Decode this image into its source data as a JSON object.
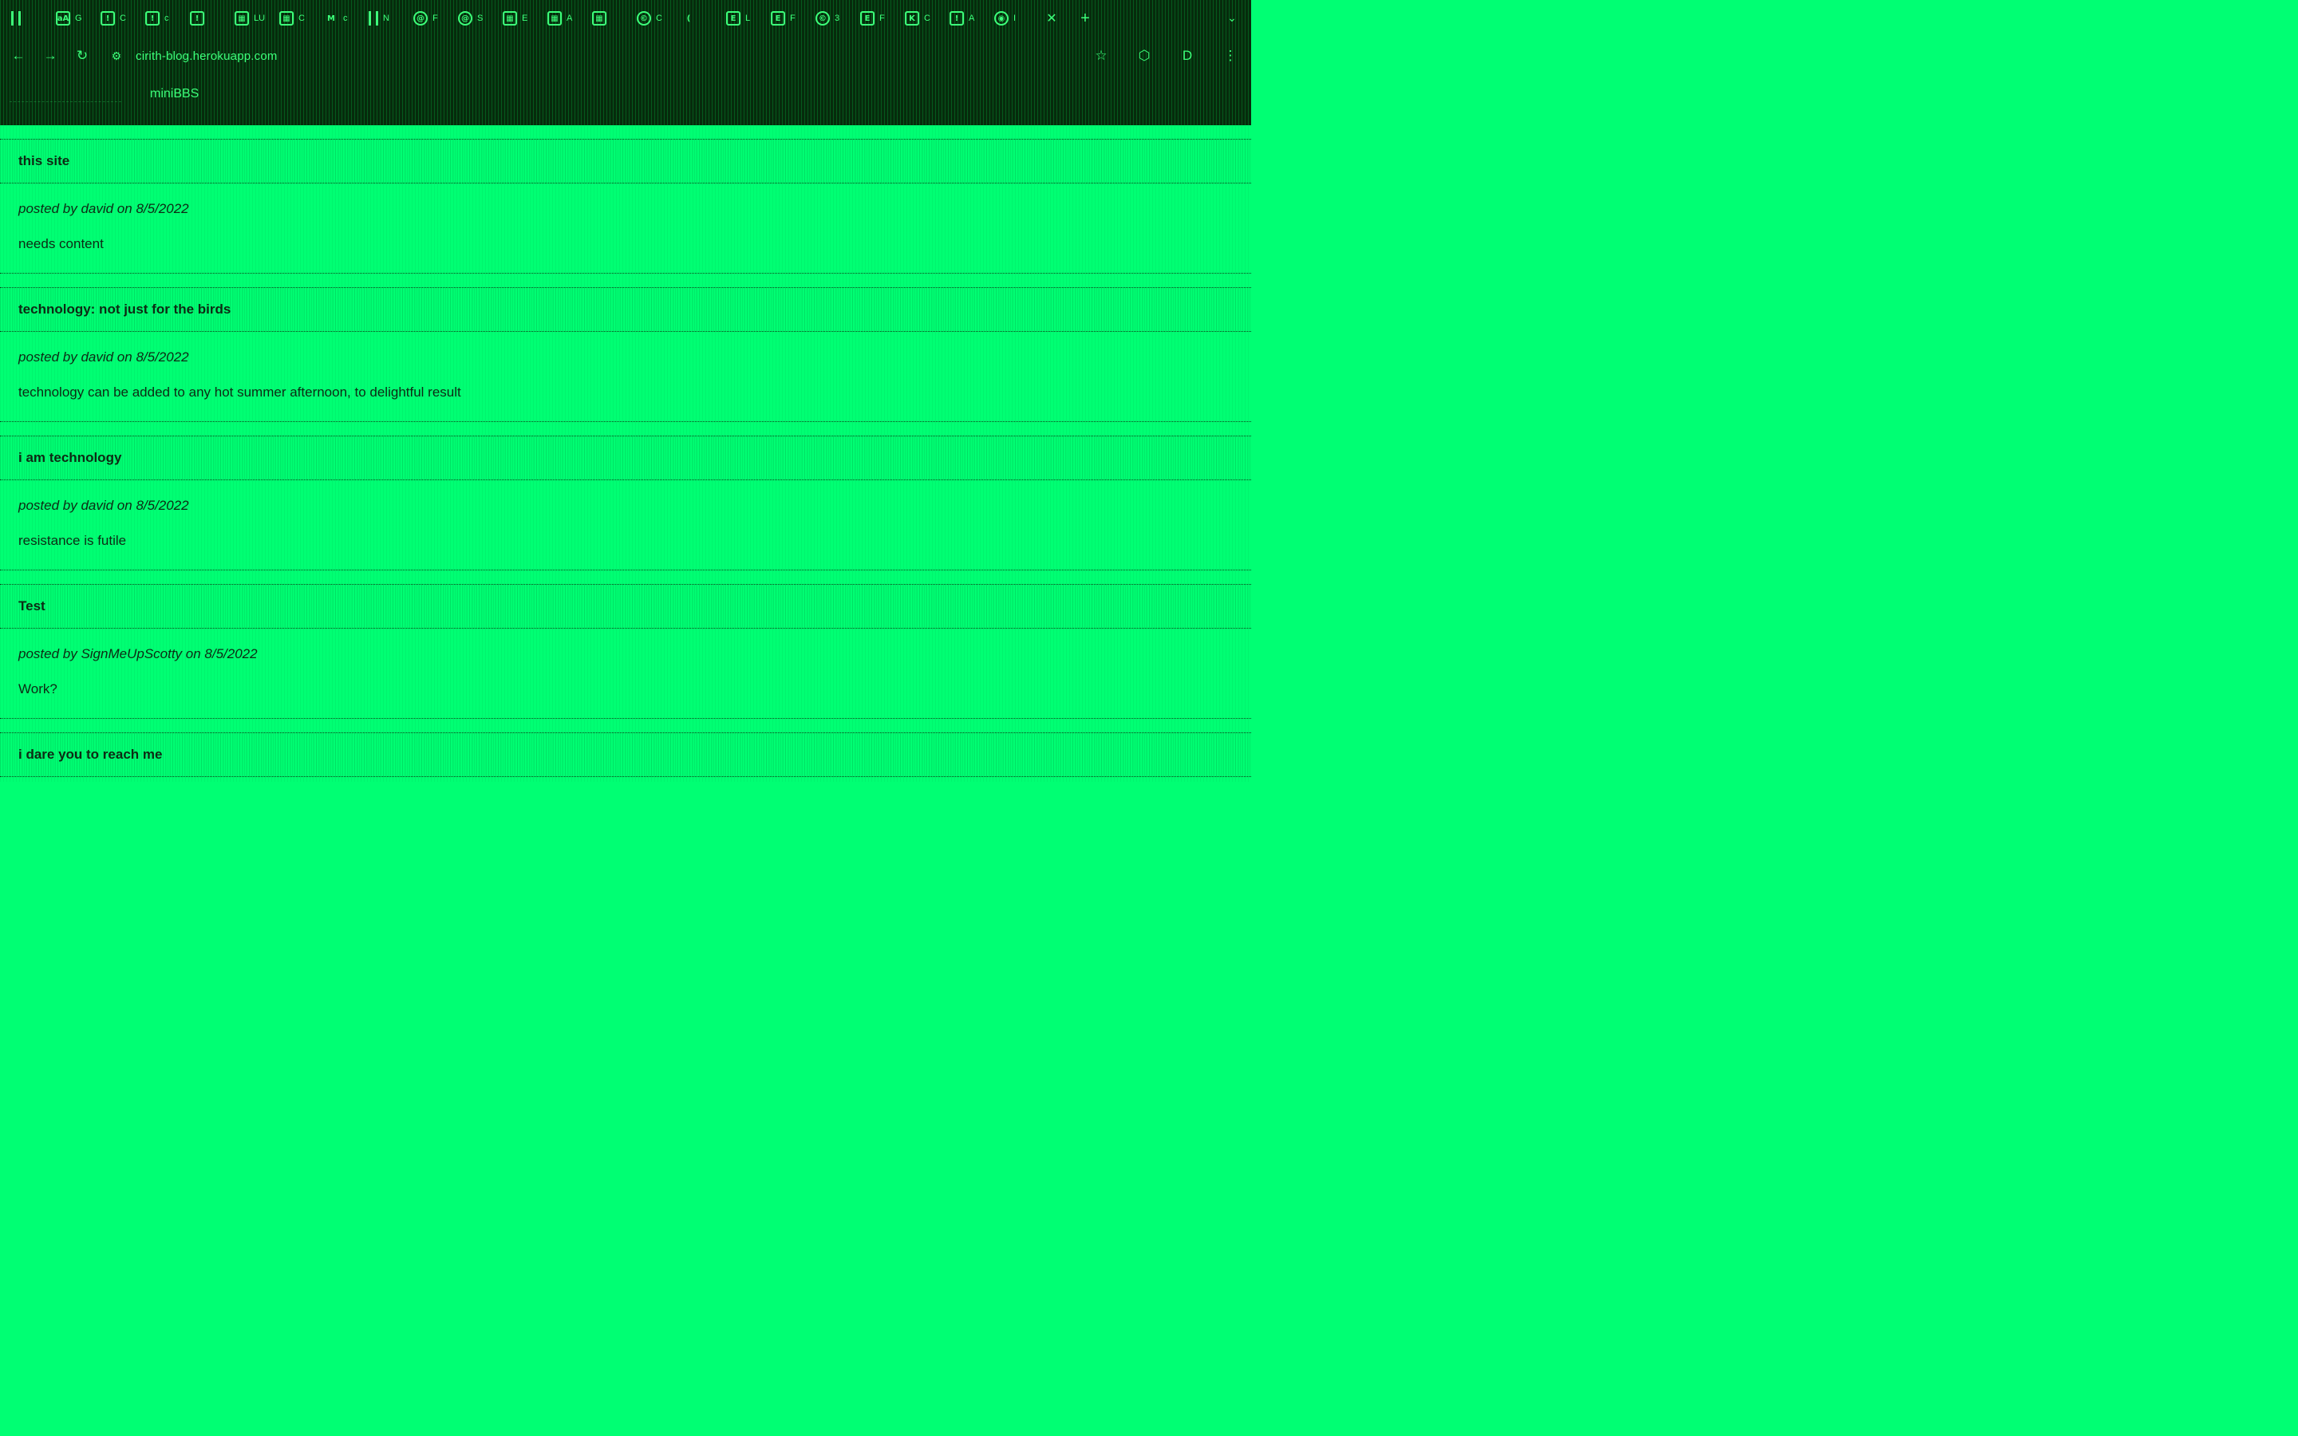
{
  "browser": {
    "tabs": [
      {
        "favicon": "bars-icon",
        "style": "bars",
        "glyph": "",
        "title": ""
      },
      {
        "favicon": "image-icon",
        "style": "box",
        "glyph": "aA",
        "title": "G"
      },
      {
        "favicon": "bookmark-icon",
        "style": "box",
        "glyph": "!",
        "title": "C"
      },
      {
        "favicon": "bookmark-icon",
        "style": "box",
        "glyph": "!",
        "title": "c"
      },
      {
        "favicon": "bookmark-icon",
        "style": "box",
        "glyph": "!",
        "title": ""
      },
      {
        "favicon": "grid-icon",
        "style": "box",
        "glyph": "▦",
        "title": "LUR"
      },
      {
        "favicon": "grid-icon",
        "style": "box",
        "glyph": "▦",
        "title": "C"
      },
      {
        "favicon": "text-icon",
        "style": "plain",
        "glyph": "M",
        "title": "c"
      },
      {
        "favicon": "bars-icon",
        "style": "bars",
        "glyph": "",
        "title": "N"
      },
      {
        "favicon": "globe-icon",
        "style": "round",
        "glyph": "@",
        "title": "F"
      },
      {
        "favicon": "globe-icon",
        "style": "round",
        "glyph": "@",
        "title": "S"
      },
      {
        "favicon": "grid-icon",
        "style": "box",
        "glyph": "▦",
        "title": "E"
      },
      {
        "favicon": "grid-icon",
        "style": "box",
        "glyph": "▦",
        "title": "A"
      },
      {
        "favicon": "grid-icon",
        "style": "box",
        "glyph": "▦",
        "title": ""
      },
      {
        "favicon": "copyright-icon",
        "style": "round",
        "glyph": "©",
        "title": "C"
      },
      {
        "favicon": "page-icon",
        "style": "plain",
        "glyph": "(",
        "title": ""
      },
      {
        "favicon": "e-icon",
        "style": "box",
        "glyph": "E",
        "title": "L"
      },
      {
        "favicon": "e-icon",
        "style": "box",
        "glyph": "E",
        "title": "F"
      },
      {
        "favicon": "copyright-icon",
        "style": "round",
        "glyph": "©",
        "title": "3"
      },
      {
        "favicon": "e-icon",
        "style": "box",
        "glyph": "E",
        "title": "F"
      },
      {
        "favicon": "k-icon",
        "style": "box",
        "glyph": "K",
        "title": "C"
      },
      {
        "favicon": "bookmark-icon",
        "style": "box",
        "glyph": "!",
        "title": "A"
      },
      {
        "favicon": "github-icon",
        "style": "round",
        "glyph": "◉",
        "title": "I"
      }
    ],
    "close_glyph": "✕",
    "new_tab_glyph": "+",
    "tab_search_glyph": "⌄",
    "toolbar": {
      "back_glyph": "←",
      "forward_glyph": "→",
      "reload_glyph": "↻",
      "site_info_glyph": "⚙",
      "url": "cirith-blog.herokuapp.com",
      "bookmark_star_glyph": "☆",
      "extension_glyph": "⬡",
      "profile_glyph": "D",
      "menu_glyph": "⋮"
    },
    "bookmarks_bar": {
      "item": "miniBBS"
    }
  },
  "posts": [
    {
      "title": "this site",
      "meta": "posted by david on 8/5/2022",
      "body": "needs content"
    },
    {
      "title": "technology: not just for the birds",
      "meta": "posted by david on 8/5/2022",
      "body": "technology can be added to any hot summer afternoon, to delightful result"
    },
    {
      "title": "i am technology",
      "meta": "posted by david on 8/5/2022",
      "body": "resistance is futile"
    },
    {
      "title": "Test",
      "meta": "posted by SignMeUpScotty on 8/5/2022",
      "body": "Work?"
    },
    {
      "title": "i dare you to reach me",
      "meta": "",
      "body": ""
    }
  ],
  "colors": {
    "page_background": "#00ff73",
    "chrome_background": "#062b0c",
    "chrome_text": "#3dff7a",
    "content_text": "#0d2a14"
  }
}
